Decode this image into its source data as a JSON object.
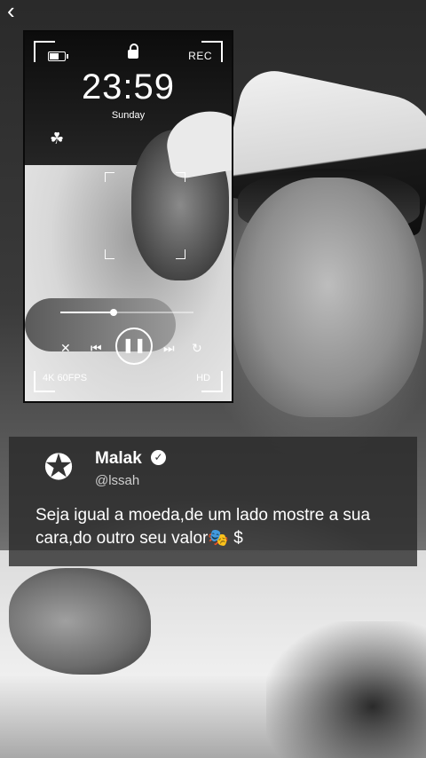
{
  "nav": {
    "back_icon": "chevron-left-icon"
  },
  "phone": {
    "rec_label": "REC",
    "time": "23:59",
    "day": "Sunday",
    "hd_label": "HD",
    "bottom_left_label": "4K 60FPS",
    "progress": 0.4
  },
  "tweet": {
    "display_name": "Malak",
    "handle": "@lssah",
    "text": "Seja igual a moeda,de um lado mostre a sua cara,do outro seu valor🎭 $"
  },
  "colors": {
    "overlay": "#282828",
    "text": "#ffffff",
    "muted": "#cfcfcf"
  }
}
